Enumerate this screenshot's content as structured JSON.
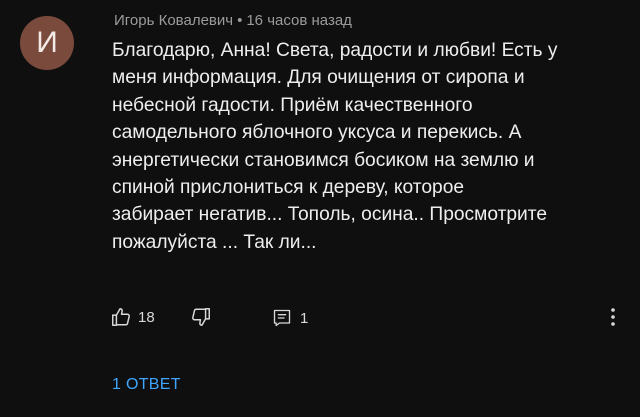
{
  "comment": {
    "avatar_letter": "И",
    "avatar_color": "#7a4a3c",
    "author": "Игорь Ковалевич",
    "separator": "•",
    "time": "16 часов назад",
    "text_lines": [
      "Благодарю, Анна! Света, радости и любви! Есть у",
      "меня информация. Для очищения от сиропа и",
      "небесной гадости. Приём качественного",
      "самодельного яблочного уксуса  и перекись. А",
      "энергетически становимся босиком на землю и",
      "спиной прислониться к дереву, которое",
      "забирает негатив... Тополь, осина..  Просмотрите",
      "пожалуйста ... Так ли..."
    ]
  },
  "actions": {
    "like_icon": "thumbs-up-icon",
    "like_count": "18",
    "dislike_icon": "thumbs-down-icon",
    "reply_icon": "reply-icon",
    "reply_count": "1",
    "more_icon": "more-vert-icon"
  },
  "replies": {
    "label": "1 ОТВЕТ",
    "link_color": "#3ea6ff"
  },
  "colors": {
    "background": "#0f0f0f",
    "text": "#eeeeee",
    "meta": "#9b9b9b"
  }
}
